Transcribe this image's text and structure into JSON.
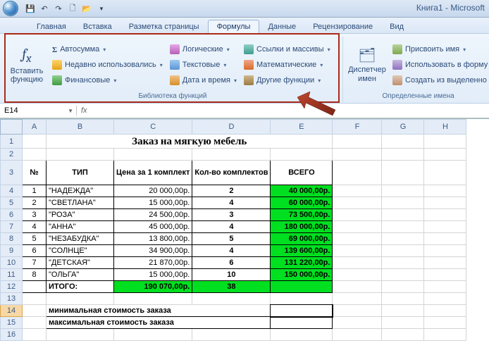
{
  "window_title": "Книга1 - Microsoft",
  "tabs": [
    "Главная",
    "Вставка",
    "Разметка страницы",
    "Формулы",
    "Данные",
    "Рецензирование",
    "Вид"
  ],
  "active_tab": "Формулы",
  "ribbon": {
    "insert_fn": "Вставить функцию",
    "library": {
      "autosum": "Автосумма",
      "recent": "Недавно использовались",
      "financial": "Финансовые",
      "logical": "Логические",
      "text": "Текстовые",
      "datetime": "Дата и время",
      "lookup": "Ссылки и массивы",
      "math": "Математические",
      "more": "Другие функции",
      "group_label": "Библиотека функций"
    },
    "names": {
      "mgr": "Диспетчер имен",
      "assign": "Присвоить имя",
      "usef": "Использовать в форму",
      "fromsel": "Создать из выделенно",
      "group_label": "Определенные имена"
    }
  },
  "namebox": "E14",
  "columns": [
    "A",
    "B",
    "C",
    "D",
    "E",
    "F",
    "G",
    "H"
  ],
  "title_text": "Заказ на мягкую мебель",
  "headers": {
    "no": "№",
    "type": "ТИП",
    "price": "Цена за 1 комплект",
    "qty": "Кол-во комплектов",
    "total": "ВСЕГО"
  },
  "rows": [
    {
      "n": "1",
      "type": "\"НАДЕЖДА\"",
      "price": "20 000,00р.",
      "qty": "2",
      "total": "40 000,00р."
    },
    {
      "n": "2",
      "type": "\"СВЕТЛАНА\"",
      "price": "15 000,00р.",
      "qty": "4",
      "total": "60 000,00р."
    },
    {
      "n": "3",
      "type": "\"РОЗА\"",
      "price": "24 500,00р.",
      "qty": "3",
      "total": "73 500,00р."
    },
    {
      "n": "4",
      "type": "\"АННА\"",
      "price": "45 000,00р.",
      "qty": "4",
      "total": "180 000,00р."
    },
    {
      "n": "5",
      "type": "\"НЕЗАБУДКА\"",
      "price": "13 800,00р.",
      "qty": "5",
      "total": "69 000,00р."
    },
    {
      "n": "6",
      "type": "\"СОЛНЦЕ\"",
      "price": "34 900,00р.",
      "qty": "4",
      "total": "139 600,00р."
    },
    {
      "n": "7",
      "type": "\"ДЕТСКАЯ\"",
      "price": "21 870,00р.",
      "qty": "6",
      "total": "131 220,00р."
    },
    {
      "n": "8",
      "type": "\"ОЛЬГА\"",
      "price": "15 000,00р.",
      "qty": "10",
      "total": "150 000,00р."
    }
  ],
  "totals": {
    "label": "ИТОГО:",
    "price": "190 070,00р.",
    "qty": "38"
  },
  "notes": {
    "min": "минимальная стоимость заказа",
    "max": "максимальная стоимость заказа"
  }
}
